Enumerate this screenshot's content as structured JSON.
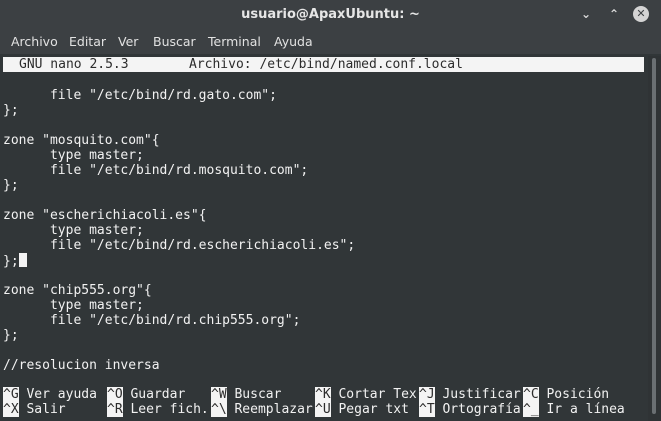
{
  "window": {
    "title": "usuario@ApaxUbuntu: ~",
    "buttons": {
      "minimize": "⌄",
      "maximize": "⌃",
      "close": "✕"
    }
  },
  "menu": [
    "Archivo",
    "Editar",
    "Ver",
    "Buscar",
    "Terminal",
    "Ayuda"
  ],
  "nano": {
    "version": "GNU nano 2.5.3",
    "file": "Archivo: /etc/bind/named.conf.local"
  },
  "editor_lines": [
    "      file \"/etc/bind/rd.gato.com\";",
    "};",
    "",
    "zone \"mosquito.com\"{",
    "      type master;",
    "      file \"/etc/bind/rd.mosquito.com\";",
    "};",
    "",
    "zone \"escherichiacoli.es\"{",
    "      type master;",
    "      file \"/etc/bind/rd.escherichiacoli.es\";",
    "};",
    "",
    "",
    "zone \"chip555.org\"{",
    "      type master;",
    "      file \"/etc/bind/rd.chip555.org\";",
    "};",
    "",
    "//resolucion inversa"
  ],
  "shortcuts": {
    "row1": [
      {
        "key": "^G",
        "label": " Ver ayuda"
      },
      {
        "key": "^O",
        "label": " Guardar"
      },
      {
        "key": "^W",
        "label": " Buscar"
      },
      {
        "key": "^K",
        "label": " Cortar Tex"
      },
      {
        "key": "^J",
        "label": " Justificar"
      },
      {
        "key": "^C",
        "label": " Posición"
      }
    ],
    "row2": [
      {
        "key": "^X",
        "label": " Salir"
      },
      {
        "key": "^R",
        "label": " Leer fich."
      },
      {
        "key": "^\\",
        "label": " Reemplazar"
      },
      {
        "key": "^U",
        "label": " Pegar txt"
      },
      {
        "key": "^T",
        "label": " Ortografía"
      },
      {
        "key": "^_",
        "label": " Ir a línea"
      }
    ]
  },
  "colors": {
    "terminal_bg": "#313638",
    "text": "#f2f2f2",
    "highlight_bg": "#f4f4f4",
    "titlebar_bg": "#3c4043"
  }
}
